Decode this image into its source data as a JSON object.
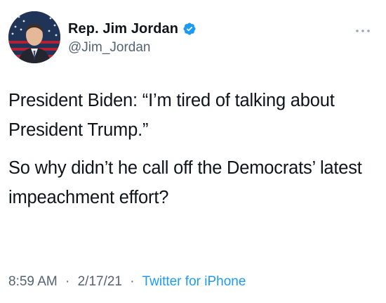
{
  "author": {
    "display_name": "Rep. Jim Jordan",
    "handle": "@Jim_Jordan",
    "verified": true,
    "verified_color": "#1d9bf0"
  },
  "tweet": {
    "paragraphs": [
      "President Biden: “I’m tired of talking about President Trump.”",
      "So why didn’t he call off the Democrats’ latest impeachment effort?"
    ]
  },
  "meta": {
    "time": "8:59 AM",
    "separator": "·",
    "date": "2/17/21",
    "source": "Twitter for iPhone"
  },
  "icons": {
    "more": "more-options-icon",
    "verified": "verified-badge-icon"
  }
}
